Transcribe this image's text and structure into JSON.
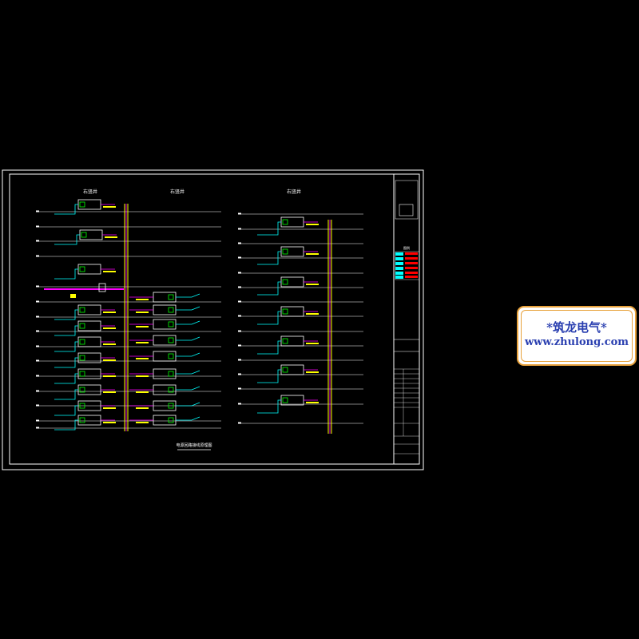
{
  "drawing": {
    "shaft_labels": [
      "右竖井",
      "右竖井",
      "右竖井"
    ],
    "caption": "电源回路接线原理图",
    "title_block_legend": "图例"
  },
  "watermark": {
    "line1": "*筑龙电气*",
    "line2": "www.zhulong.com"
  },
  "colors": {
    "background": "#000000",
    "frame": "#ffffff",
    "cyan": "#00ffff",
    "magenta": "#ff00ff",
    "yellow": "#ffff00",
    "green": "#00ff00",
    "red": "#ff0000",
    "watermark_border": "#e8a23c",
    "watermark_text": "#2a3fb0"
  }
}
